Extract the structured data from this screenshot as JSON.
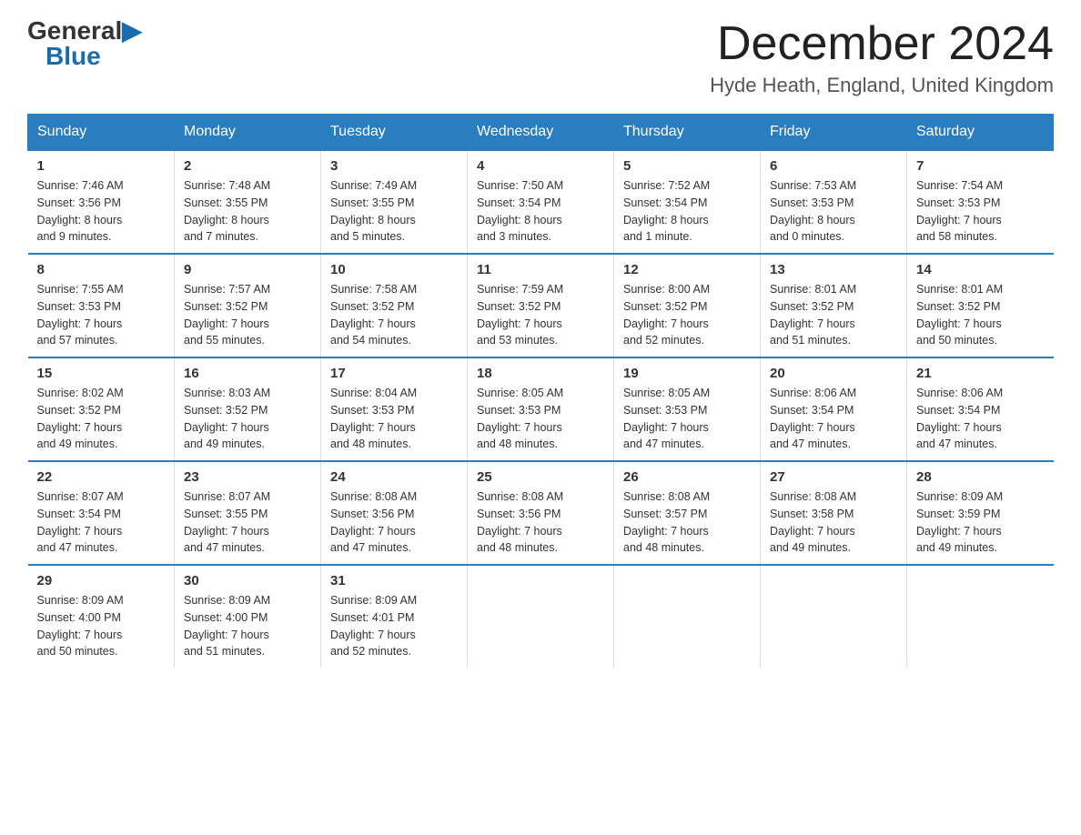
{
  "header": {
    "logo_general": "General",
    "logo_blue": "Blue",
    "title": "December 2024",
    "subtitle": "Hyde Heath, England, United Kingdom"
  },
  "weekdays": [
    "Sunday",
    "Monday",
    "Tuesday",
    "Wednesday",
    "Thursday",
    "Friday",
    "Saturday"
  ],
  "weeks": [
    [
      {
        "day": "1",
        "info": "Sunrise: 7:46 AM\nSunset: 3:56 PM\nDaylight: 8 hours\nand 9 minutes."
      },
      {
        "day": "2",
        "info": "Sunrise: 7:48 AM\nSunset: 3:55 PM\nDaylight: 8 hours\nand 7 minutes."
      },
      {
        "day": "3",
        "info": "Sunrise: 7:49 AM\nSunset: 3:55 PM\nDaylight: 8 hours\nand 5 minutes."
      },
      {
        "day": "4",
        "info": "Sunrise: 7:50 AM\nSunset: 3:54 PM\nDaylight: 8 hours\nand 3 minutes."
      },
      {
        "day": "5",
        "info": "Sunrise: 7:52 AM\nSunset: 3:54 PM\nDaylight: 8 hours\nand 1 minute."
      },
      {
        "day": "6",
        "info": "Sunrise: 7:53 AM\nSunset: 3:53 PM\nDaylight: 8 hours\nand 0 minutes."
      },
      {
        "day": "7",
        "info": "Sunrise: 7:54 AM\nSunset: 3:53 PM\nDaylight: 7 hours\nand 58 minutes."
      }
    ],
    [
      {
        "day": "8",
        "info": "Sunrise: 7:55 AM\nSunset: 3:53 PM\nDaylight: 7 hours\nand 57 minutes."
      },
      {
        "day": "9",
        "info": "Sunrise: 7:57 AM\nSunset: 3:52 PM\nDaylight: 7 hours\nand 55 minutes."
      },
      {
        "day": "10",
        "info": "Sunrise: 7:58 AM\nSunset: 3:52 PM\nDaylight: 7 hours\nand 54 minutes."
      },
      {
        "day": "11",
        "info": "Sunrise: 7:59 AM\nSunset: 3:52 PM\nDaylight: 7 hours\nand 53 minutes."
      },
      {
        "day": "12",
        "info": "Sunrise: 8:00 AM\nSunset: 3:52 PM\nDaylight: 7 hours\nand 52 minutes."
      },
      {
        "day": "13",
        "info": "Sunrise: 8:01 AM\nSunset: 3:52 PM\nDaylight: 7 hours\nand 51 minutes."
      },
      {
        "day": "14",
        "info": "Sunrise: 8:01 AM\nSunset: 3:52 PM\nDaylight: 7 hours\nand 50 minutes."
      }
    ],
    [
      {
        "day": "15",
        "info": "Sunrise: 8:02 AM\nSunset: 3:52 PM\nDaylight: 7 hours\nand 49 minutes."
      },
      {
        "day": "16",
        "info": "Sunrise: 8:03 AM\nSunset: 3:52 PM\nDaylight: 7 hours\nand 49 minutes."
      },
      {
        "day": "17",
        "info": "Sunrise: 8:04 AM\nSunset: 3:53 PM\nDaylight: 7 hours\nand 48 minutes."
      },
      {
        "day": "18",
        "info": "Sunrise: 8:05 AM\nSunset: 3:53 PM\nDaylight: 7 hours\nand 48 minutes."
      },
      {
        "day": "19",
        "info": "Sunrise: 8:05 AM\nSunset: 3:53 PM\nDaylight: 7 hours\nand 47 minutes."
      },
      {
        "day": "20",
        "info": "Sunrise: 8:06 AM\nSunset: 3:54 PM\nDaylight: 7 hours\nand 47 minutes."
      },
      {
        "day": "21",
        "info": "Sunrise: 8:06 AM\nSunset: 3:54 PM\nDaylight: 7 hours\nand 47 minutes."
      }
    ],
    [
      {
        "day": "22",
        "info": "Sunrise: 8:07 AM\nSunset: 3:54 PM\nDaylight: 7 hours\nand 47 minutes."
      },
      {
        "day": "23",
        "info": "Sunrise: 8:07 AM\nSunset: 3:55 PM\nDaylight: 7 hours\nand 47 minutes."
      },
      {
        "day": "24",
        "info": "Sunrise: 8:08 AM\nSunset: 3:56 PM\nDaylight: 7 hours\nand 47 minutes."
      },
      {
        "day": "25",
        "info": "Sunrise: 8:08 AM\nSunset: 3:56 PM\nDaylight: 7 hours\nand 48 minutes."
      },
      {
        "day": "26",
        "info": "Sunrise: 8:08 AM\nSunset: 3:57 PM\nDaylight: 7 hours\nand 48 minutes."
      },
      {
        "day": "27",
        "info": "Sunrise: 8:08 AM\nSunset: 3:58 PM\nDaylight: 7 hours\nand 49 minutes."
      },
      {
        "day": "28",
        "info": "Sunrise: 8:09 AM\nSunset: 3:59 PM\nDaylight: 7 hours\nand 49 minutes."
      }
    ],
    [
      {
        "day": "29",
        "info": "Sunrise: 8:09 AM\nSunset: 4:00 PM\nDaylight: 7 hours\nand 50 minutes."
      },
      {
        "day": "30",
        "info": "Sunrise: 8:09 AM\nSunset: 4:00 PM\nDaylight: 7 hours\nand 51 minutes."
      },
      {
        "day": "31",
        "info": "Sunrise: 8:09 AM\nSunset: 4:01 PM\nDaylight: 7 hours\nand 52 minutes."
      },
      null,
      null,
      null,
      null
    ]
  ]
}
